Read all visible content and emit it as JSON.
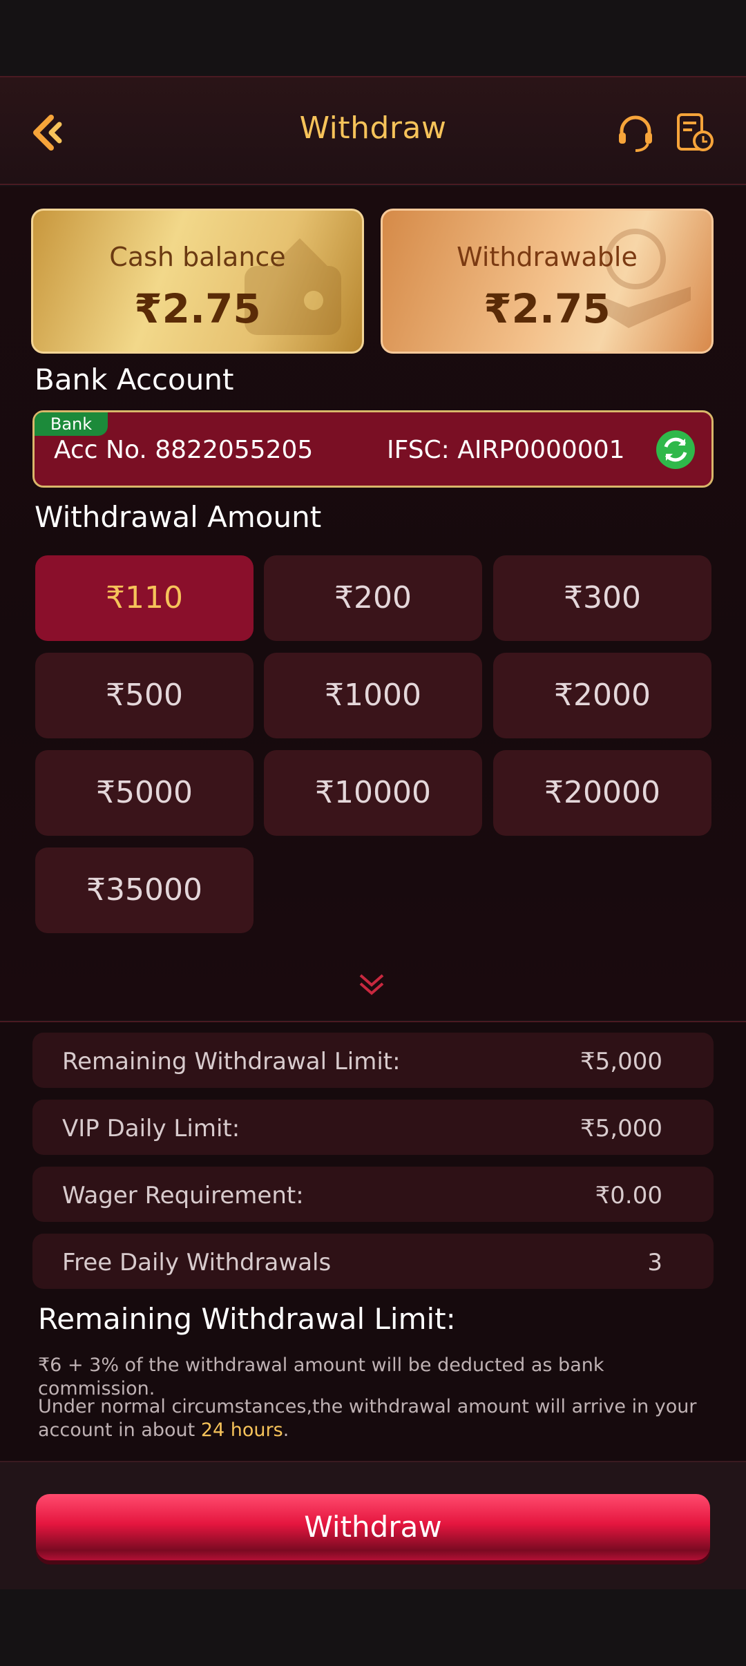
{
  "header": {
    "title": "Withdraw"
  },
  "balances": {
    "cash_label": "Cash balance",
    "cash_amount": "₹2.75",
    "withdrawable_label": "Withdrawable",
    "withdrawable_amount": "₹2.75"
  },
  "bank": {
    "section_title": "Bank Account",
    "tag": "Bank",
    "acc_no": "Acc No. 8822055205",
    "ifsc": "IFSC: AIRP0000001"
  },
  "amount": {
    "section_title": "Withdrawal Amount",
    "selected": "₹110",
    "options": [
      "₹110",
      "₹200",
      "₹300",
      "₹500",
      "₹1000",
      "₹2000",
      "₹5000",
      "₹10000",
      "₹20000",
      "₹35000"
    ]
  },
  "limits": [
    {
      "label": "Remaining Withdrawal Limit:",
      "value": "₹5,000"
    },
    {
      "label": "VIP Daily Limit:",
      "value": "₹5,000"
    },
    {
      "label": "Wager Requirement:",
      "value": "₹0.00"
    },
    {
      "label": "Free Daily Withdrawals",
      "value": "3"
    }
  ],
  "rules": {
    "title": "Remaining Withdrawal Limit:",
    "rule1": "₹6 + 3% of the withdrawal amount will be deducted as bank commission.",
    "rule2_prefix": "Under normal circumstances,the withdrawal amount will arrive in your account in about ",
    "rule2_highlight": "24 hours",
    "rule2_suffix": "."
  },
  "footer": {
    "withdraw_label": "Withdraw"
  },
  "colors": {
    "accent_gold": "#f6c35a",
    "selected_bg": "#8a0f2b",
    "button_red": "#e5163f",
    "bank_tag_green": "#1c8a3a"
  }
}
